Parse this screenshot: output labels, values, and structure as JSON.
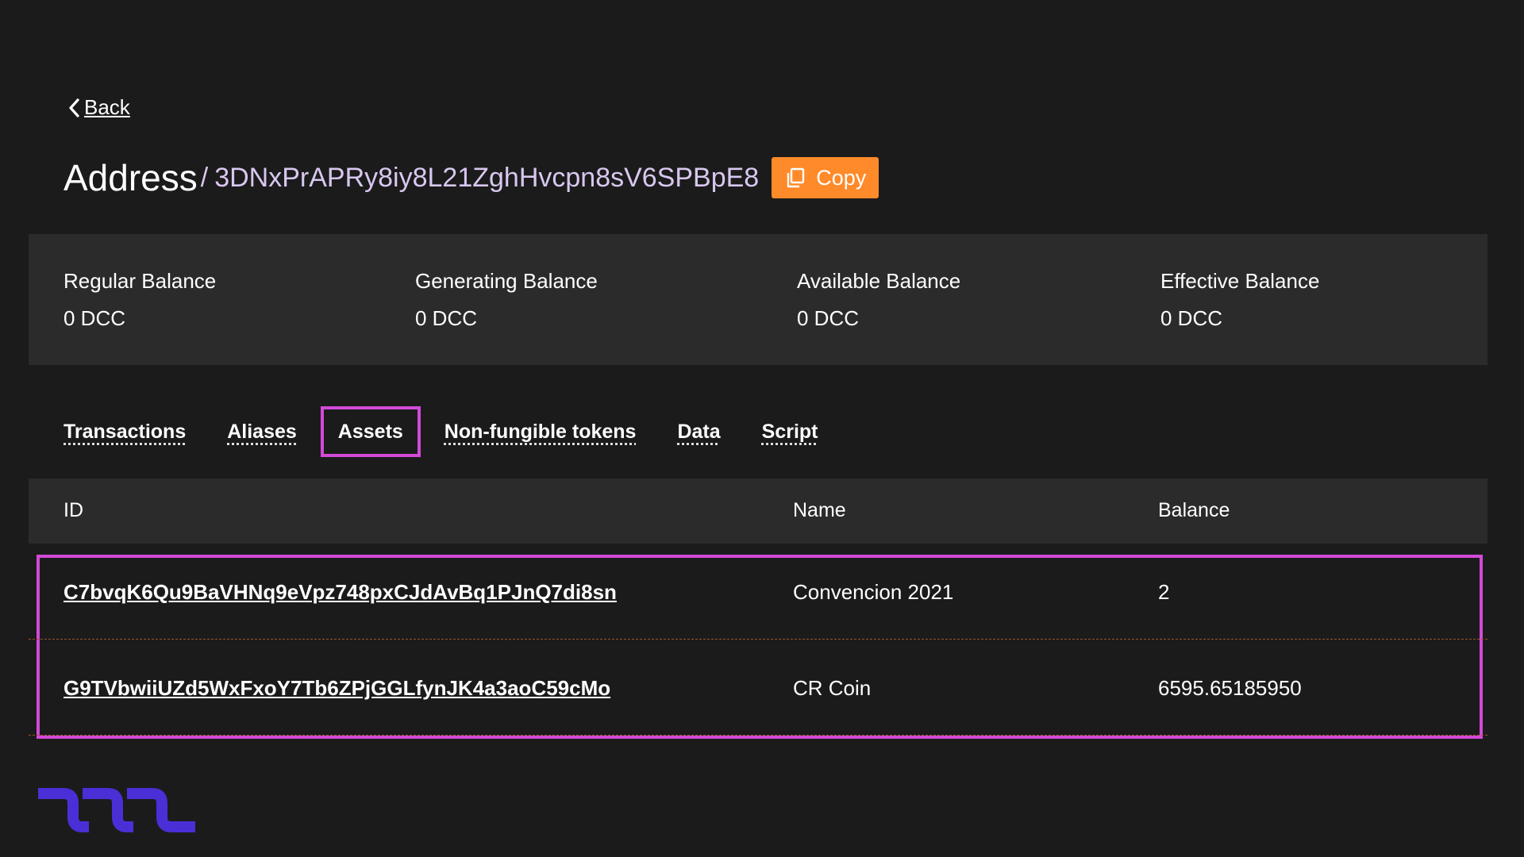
{
  "nav": {
    "back_label": "Back"
  },
  "header": {
    "title": "Address",
    "separator": "/",
    "address": "3DNxPrAPRy8iy8L21ZghHvcpn8sV6SPBpE8",
    "copy_label": "Copy"
  },
  "balances": [
    {
      "label": "Regular Balance",
      "value": "0 DCC"
    },
    {
      "label": "Generating Balance",
      "value": "0 DCC"
    },
    {
      "label": "Available Balance",
      "value": "0 DCC"
    },
    {
      "label": "Effective Balance",
      "value": "0 DCC"
    }
  ],
  "tabs": [
    {
      "label": "Transactions",
      "active": false
    },
    {
      "label": "Aliases",
      "active": false
    },
    {
      "label": "Assets",
      "active": true
    },
    {
      "label": "Non-fungible tokens",
      "active": false
    },
    {
      "label": "Data",
      "active": false
    },
    {
      "label": "Script",
      "active": false
    }
  ],
  "table": {
    "headers": [
      "ID",
      "Name",
      "Balance"
    ],
    "rows": [
      {
        "id": "C7bvqK6Qu9BaVHNq9eVpz748pxCJdAvBq1PJnQ7di8sn",
        "name": "Convencion 2021",
        "balance": "2"
      },
      {
        "id": "G9TVbwiiUZd5WxFxoY7Tb6ZPjGGLfynJK4a3aoC59cMo",
        "name": "CR Coin",
        "balance": "6595.65185950"
      }
    ]
  },
  "colors": {
    "background": "#1b1b1b",
    "panel": "#2b2b2b",
    "accent_orange": "#ff8a2a",
    "highlight_magenta": "#d24ad8",
    "address_text": "#d8c7ef",
    "logo_purple": "#4a2fd6"
  },
  "icons": {
    "back": "chevron-left-icon",
    "copy": "copy-icon",
    "logo": "wave-logo"
  }
}
